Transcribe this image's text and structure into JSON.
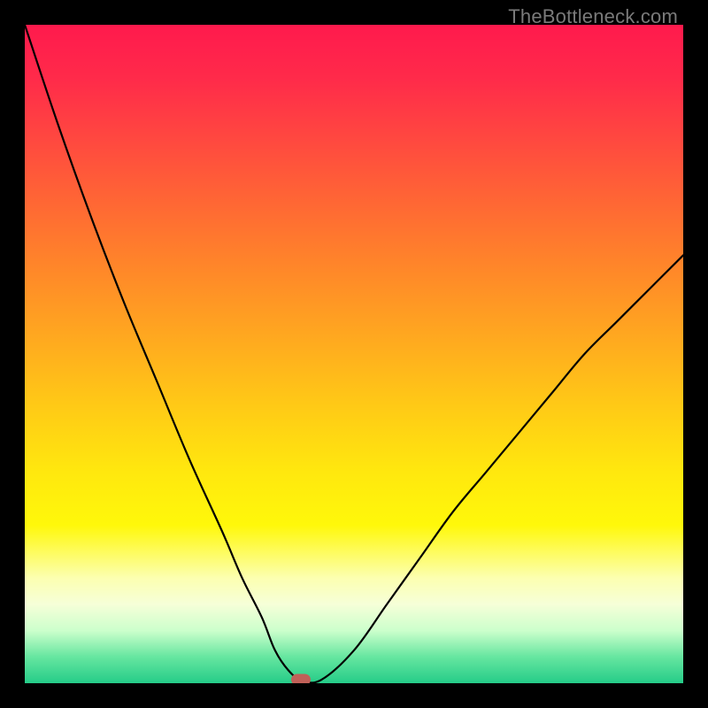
{
  "watermark": "TheBottleneck.com",
  "chart_data": {
    "type": "line",
    "title": "",
    "xlabel": "",
    "ylabel": "",
    "xlim": [
      0,
      100
    ],
    "ylim": [
      0,
      100
    ],
    "grid": false,
    "legend": false,
    "series": [
      {
        "name": "curve",
        "x": [
          0,
          5,
          10,
          15,
          20,
          25,
          30,
          33,
          36,
          38,
          40,
          42,
          45,
          50,
          55,
          60,
          65,
          70,
          75,
          80,
          85,
          90,
          95,
          100
        ],
        "values": [
          100,
          85,
          71,
          58,
          46,
          34,
          23,
          16,
          10,
          5,
          2,
          0.5,
          0.5,
          5,
          12,
          19,
          26,
          32,
          38,
          44,
          50,
          55,
          60,
          65
        ]
      }
    ],
    "marker": {
      "x": 42,
      "y": 0.5,
      "color": "#c06058"
    },
    "background_gradient": {
      "top": "#ff1a4d",
      "mid": "#ffe80e",
      "bottom": "#25cc88"
    }
  }
}
